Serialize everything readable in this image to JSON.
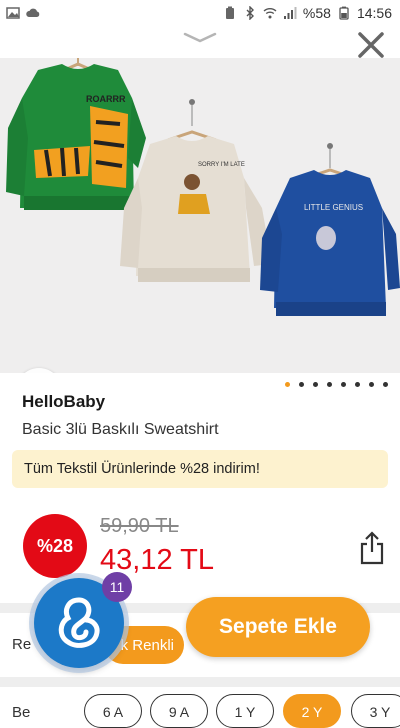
{
  "status_bar": {
    "battery": "%58",
    "time": "14:56"
  },
  "product": {
    "brand": "HelloBaby",
    "title": "Basic 3lü Baskılı Sweatshirt",
    "promo": "Tüm Tekstil Ürünlerinde %28 indirim!",
    "discount_badge": "%28",
    "old_price": "59,90 TL",
    "new_price": "43,12 TL",
    "image_pager": {
      "total": 8,
      "active_index": 0
    },
    "image_texts": {
      "green_shirt": "ROARRR",
      "beige_shirt": "SORRY I'M LATE",
      "blue_shirt": "LITTLE GENIUS"
    }
  },
  "variants": {
    "color_label": "Re",
    "color_chip": "k Renkli",
    "size_label": "Be",
    "sizes": [
      {
        "label": "6 A",
        "selected": false
      },
      {
        "label": "9 A",
        "selected": false
      },
      {
        "label": "1 Y",
        "selected": false
      },
      {
        "label": "2 Y",
        "selected": true
      },
      {
        "label": "3 Y",
        "selected": false
      }
    ]
  },
  "actions": {
    "add_to_cart": "Sepete Ekle"
  },
  "assistant": {
    "badge_count": "11"
  },
  "colors": {
    "accent_orange": "#f5a021",
    "price_red": "#e30a16",
    "promo_bg": "#fdf2cf",
    "assistant_blue": "#1c79c8",
    "badge_purple": "#6f3fa6"
  }
}
